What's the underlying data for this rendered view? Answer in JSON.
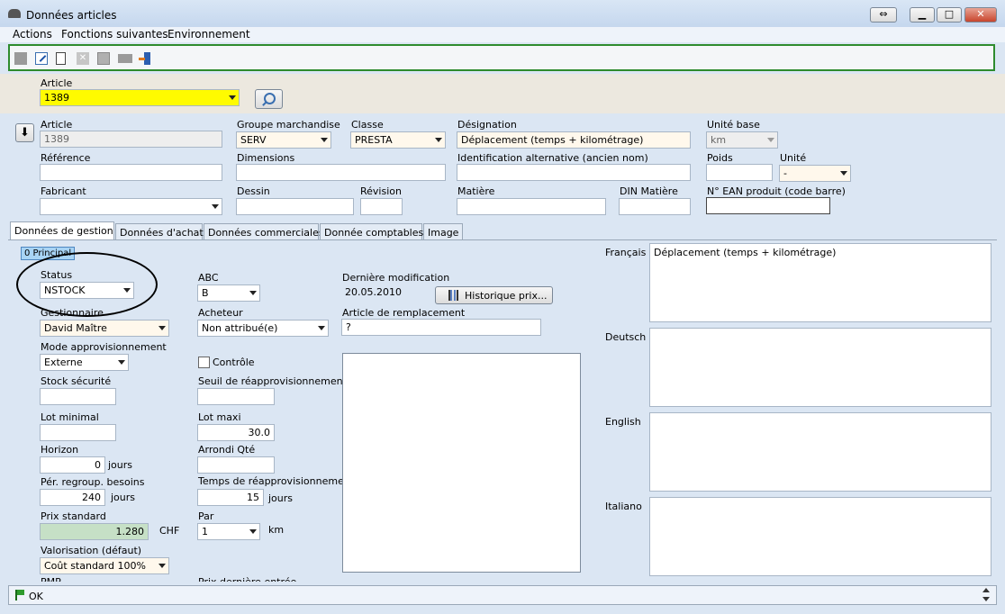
{
  "window": {
    "title": "Données articles"
  },
  "menu": [
    "Actions",
    "Fonctions suivantes",
    "Environnement"
  ],
  "toolbar": {
    "icons": [
      "stop-icon",
      "edit-icon",
      "new-doc-icon",
      "delete-icon",
      "copy-icon",
      "print-icon",
      "exit-icon"
    ]
  },
  "article_bar": {
    "label": "Article",
    "value": "1389"
  },
  "header": {
    "article": {
      "label": "Article",
      "value": "1389"
    },
    "groupe": {
      "label": "Groupe marchandise",
      "value": "SERV"
    },
    "classe": {
      "label": "Classe",
      "value": "PRESTA"
    },
    "designation": {
      "label": "Désignation",
      "value": "Déplacement (temps + kilométrage)"
    },
    "unite_base": {
      "label": "Unité base",
      "value": "km"
    },
    "reference": {
      "label": "Référence",
      "value": ""
    },
    "dimensions": {
      "label": "Dimensions",
      "value": ""
    },
    "ident_alt": {
      "label": "Identification alternative (ancien nom)",
      "value": ""
    },
    "poids": {
      "label": "Poids",
      "value": ""
    },
    "unite": {
      "label": "Unité",
      "value": "-"
    },
    "fabricant": {
      "label": "Fabricant",
      "value": ""
    },
    "dessin": {
      "label": "Dessin",
      "value": ""
    },
    "revision": {
      "label": "Révision",
      "value": ""
    },
    "matiere": {
      "label": "Matière",
      "value": ""
    },
    "din": {
      "label": "DIN Matière",
      "value": ""
    },
    "ean": {
      "label": "N° EAN produit (code barre)",
      "value": ""
    }
  },
  "tabs": [
    "Données de gestion",
    "Données d'achat",
    "Données commerciales",
    "Donnée comptables",
    "Image"
  ],
  "subtab": "0 Principal",
  "gestion": {
    "status": {
      "label": "Status",
      "value": "NSTOCK"
    },
    "gestionnaire": {
      "label": "Gestionnaire",
      "value": "David Maître"
    },
    "mode": {
      "label": "Mode approvisionnement",
      "value": "Externe"
    },
    "stock_secu": {
      "label": "Stock sécurité",
      "value": ""
    },
    "lot_min": {
      "label": "Lot minimal",
      "value": ""
    },
    "horizon": {
      "label": "Horizon",
      "value": "0",
      "unit": "jours"
    },
    "per_regroup": {
      "label": "Pér. regroup. besoins",
      "value": "240",
      "unit": "jours"
    },
    "prix_std": {
      "label": "Prix standard",
      "value": "1.280",
      "unit": "CHF"
    },
    "valorisation": {
      "label": "Valorisation (défaut)",
      "value": "Coût standard 100%"
    },
    "pmp": {
      "label": "PMP"
    },
    "abc": {
      "label": "ABC",
      "value": "B"
    },
    "acheteur": {
      "label": "Acheteur",
      "value": "Non attribué(e)"
    },
    "controle": {
      "label": "Contrôle"
    },
    "seuil": {
      "label": "Seuil de réapprovisionnement",
      "value": ""
    },
    "lot_maxi": {
      "label": "Lot maxi",
      "value": "30.0"
    },
    "arrondi": {
      "label": "Arrondi Qté",
      "value": ""
    },
    "temps_reappro": {
      "label": "Temps de réapprovisionnement",
      "value": "15",
      "unit": "jours"
    },
    "par": {
      "label": "Par",
      "value": "1",
      "unit": "km"
    },
    "prix_derniere": {
      "label": "Prix dernière entrée"
    },
    "derniere_modif": {
      "label": "Dernière modification",
      "value": "20.05.2010"
    },
    "historique": {
      "label": "Historique prix..."
    },
    "remplacement": {
      "label": "Article de remplacement",
      "value": "?"
    }
  },
  "langs": [
    {
      "label": "Français",
      "text": "Déplacement (temps + kilométrage)"
    },
    {
      "label": "Deutsch",
      "text": ""
    },
    {
      "label": "English",
      "text": ""
    },
    {
      "label": "Italiano",
      "text": ""
    }
  ],
  "status_bar": {
    "text": "OK"
  }
}
